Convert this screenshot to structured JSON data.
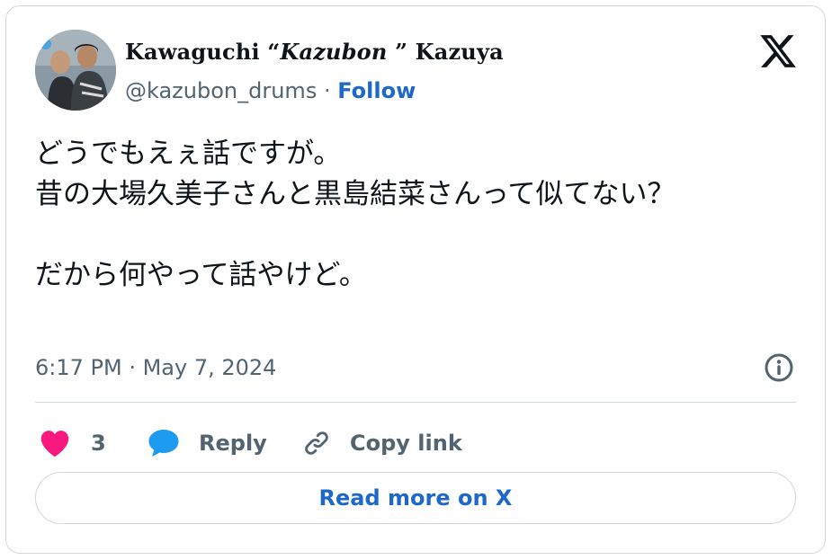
{
  "author": {
    "display_name_part1": "Kawaguchi “",
    "display_name_italic": "Kazubon",
    "display_name_part2": " ” Kazuya",
    "handle": "@kazubon_drums",
    "separator": "·",
    "follow_label": "Follow"
  },
  "tweet": {
    "text": "どうでもえぇ話ですが。\n昔の大場久美子さんと黒島結菜さんって似てない？\n\nだから何やって話やけど。",
    "timestamp": "6:17 PM · May 7, 2024"
  },
  "actions": {
    "like_count": "3",
    "reply_label": "Reply",
    "copy_label": "Copy link"
  },
  "read_more_label": "Read more on X",
  "colors": {
    "like": "#f91880",
    "reply": "#1d9bf0",
    "link": "#1d68c9",
    "secondary": "#536471",
    "border": "#cfd9de"
  },
  "icons": {
    "brand": "x-logo-icon",
    "info": "info-icon",
    "like": "heart-icon",
    "reply": "speech-bubble-icon",
    "copy": "link-icon"
  }
}
